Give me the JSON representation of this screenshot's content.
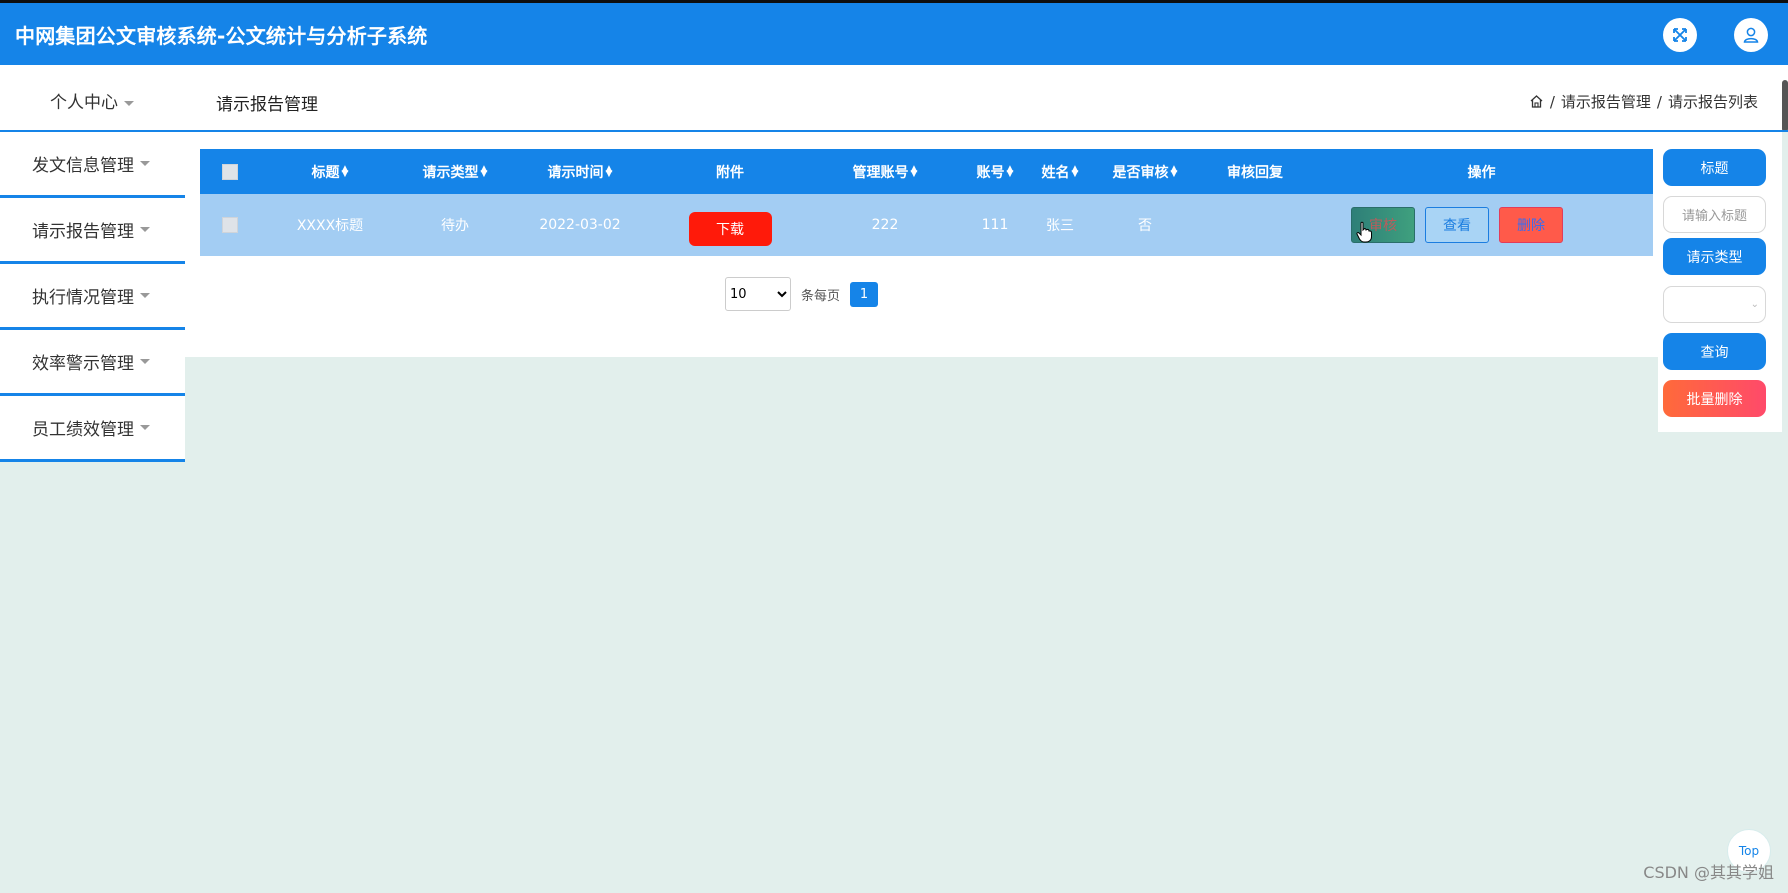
{
  "app": {
    "title": "中网集团公文审核系统-公文统计与分析子系统"
  },
  "topbar": {
    "personal_center": "个人中心",
    "page_heading": "请示报告管理",
    "breadcrumb": [
      "请示报告管理",
      "请示报告列表"
    ]
  },
  "sidebar": {
    "items": [
      {
        "label": "发文信息管理"
      },
      {
        "label": "请示报告管理"
      },
      {
        "label": "执行情况管理"
      },
      {
        "label": "效率警示管理"
      },
      {
        "label": "员工绩效管理"
      }
    ]
  },
  "table": {
    "headers": {
      "title": "标题",
      "type": "请示类型",
      "time": "请示时间",
      "attachment": "附件",
      "manager_account": "管理账号",
      "account": "账号",
      "name": "姓名",
      "reviewed": "是否审核",
      "reply": "审核回复",
      "actions": "操作"
    },
    "rows": [
      {
        "title": "XXXX标题",
        "type": "待办",
        "time": "2022-03-02",
        "attachment_button": "下载",
        "manager_account": "222",
        "account": "111",
        "name": "张三",
        "reviewed": "否",
        "reply": "",
        "audit_button": "审核",
        "view_button": "查看",
        "delete_button": "删除"
      }
    ]
  },
  "pagination": {
    "page_size": "10",
    "per_page_label": "条每页",
    "current_page": "1"
  },
  "search_panel": {
    "title_label": "标题",
    "title_placeholder": "请输入标题",
    "type_label": "请示类型",
    "type_value": "",
    "query_button": "查询",
    "batch_delete_button": "批量删除"
  },
  "misc": {
    "top_button": "Top",
    "watermark": "CSDN @其其学姐"
  }
}
